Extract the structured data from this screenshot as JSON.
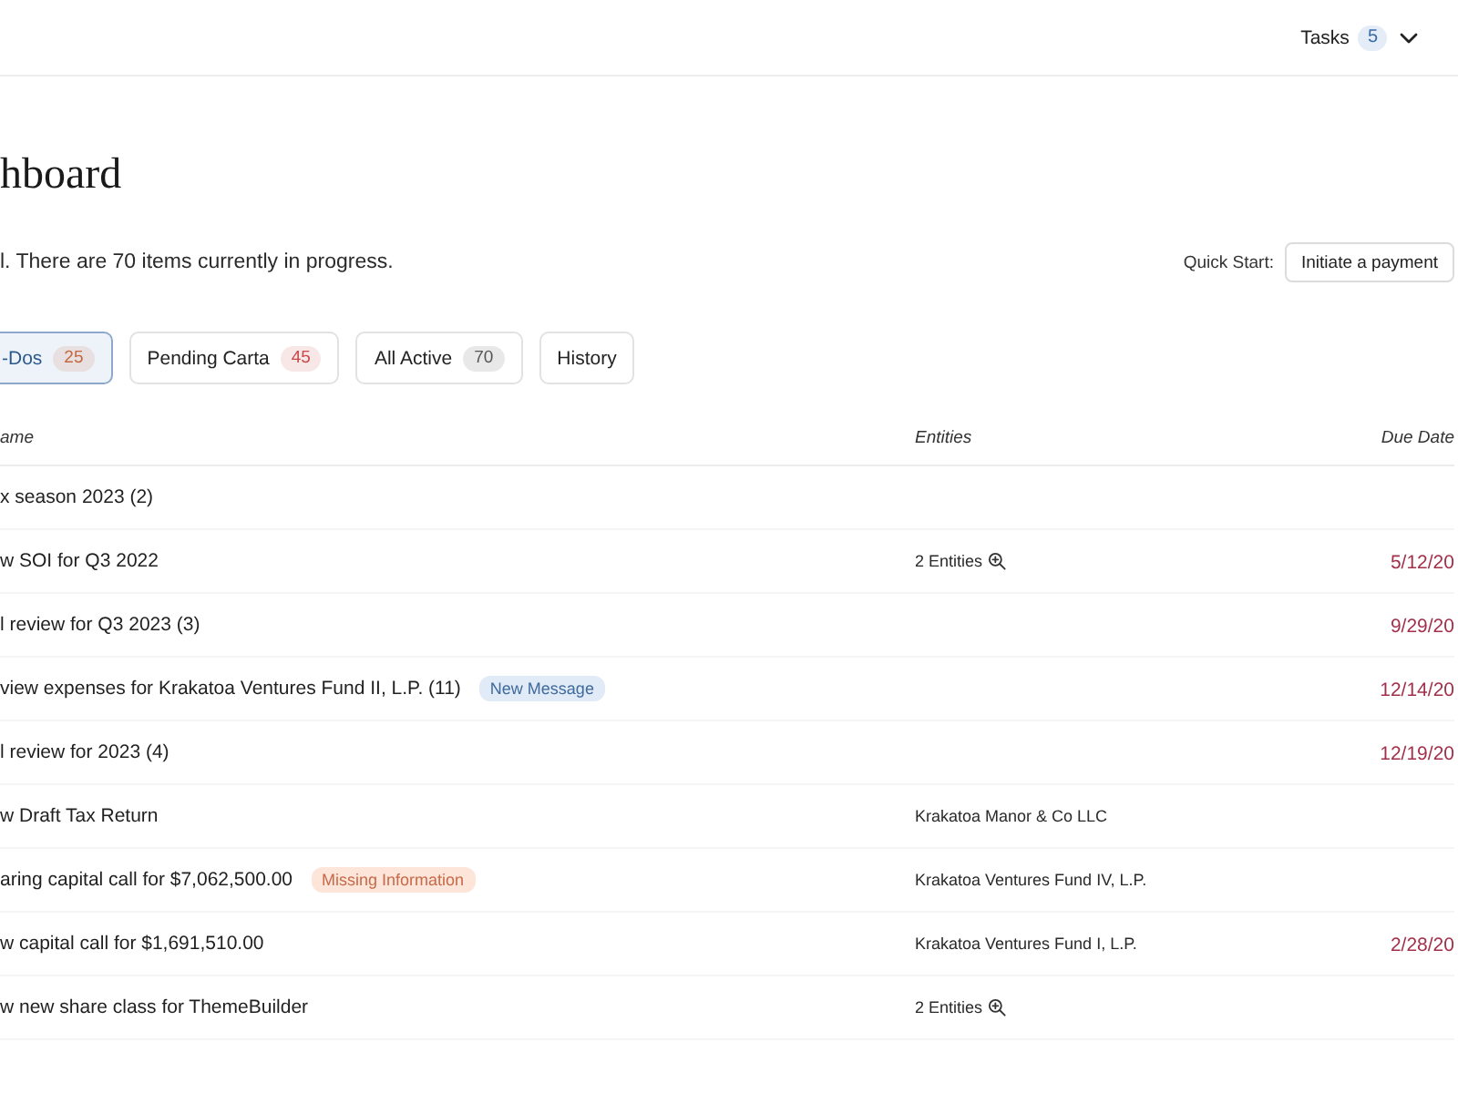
{
  "top_bar": {
    "tasks": {
      "label": "Tasks",
      "count": "5"
    }
  },
  "page": {
    "title": "hboard",
    "summary": "l. There are 70 items currently in progress.",
    "quick_start": {
      "label": "Quick Start:",
      "button": "Initiate a payment"
    }
  },
  "tabs": [
    {
      "label": "-Dos",
      "count": "25",
      "color": "#c4673f",
      "selected": true
    },
    {
      "label": "Pending Carta",
      "count": "45",
      "color": "#c9484a",
      "selected": false
    },
    {
      "label": "All Active",
      "count": "70",
      "color": "#555555",
      "selected": false
    },
    {
      "label": "History",
      "selected": false
    }
  ],
  "table": {
    "columns": [
      "ame",
      "Entities",
      "Due Date"
    ],
    "rows": [
      {
        "name": "x season 2023 (2)"
      },
      {
        "name": "w SOI for Q3 2022",
        "entities": {
          "text": "2 Entities",
          "kind": "multiple"
        },
        "due": "5/12/20"
      },
      {
        "name": "l review for Q3 2023 (3)",
        "due": "9/29/20"
      },
      {
        "name": "view expenses for Krakatoa Ventures Fund II, L.P. (11)",
        "tag": {
          "text": "New Message",
          "kind": "info"
        },
        "due": "12/14/20"
      },
      {
        "name": "l review for 2023 (4)",
        "due": "12/19/20"
      },
      {
        "name": "w Draft Tax Return",
        "entities": {
          "text": "Krakatoa Manor & Co LLC",
          "kind": "single"
        }
      },
      {
        "name": "aring capital call for $7,062,500.00",
        "tag": {
          "text": "Missing Information",
          "kind": "warning"
        },
        "entities": {
          "text": "Krakatoa Ventures Fund IV, L.P.",
          "kind": "single"
        }
      },
      {
        "name": "w capital call for $1,691,510.00",
        "entities": {
          "text": "Krakatoa Ventures Fund I, L.P.",
          "kind": "single"
        },
        "due": "2/28/20"
      },
      {
        "name": "w new share class for ThemeBuilder",
        "entities": {
          "text": "2 Entities",
          "kind": "multiple"
        }
      }
    ]
  }
}
